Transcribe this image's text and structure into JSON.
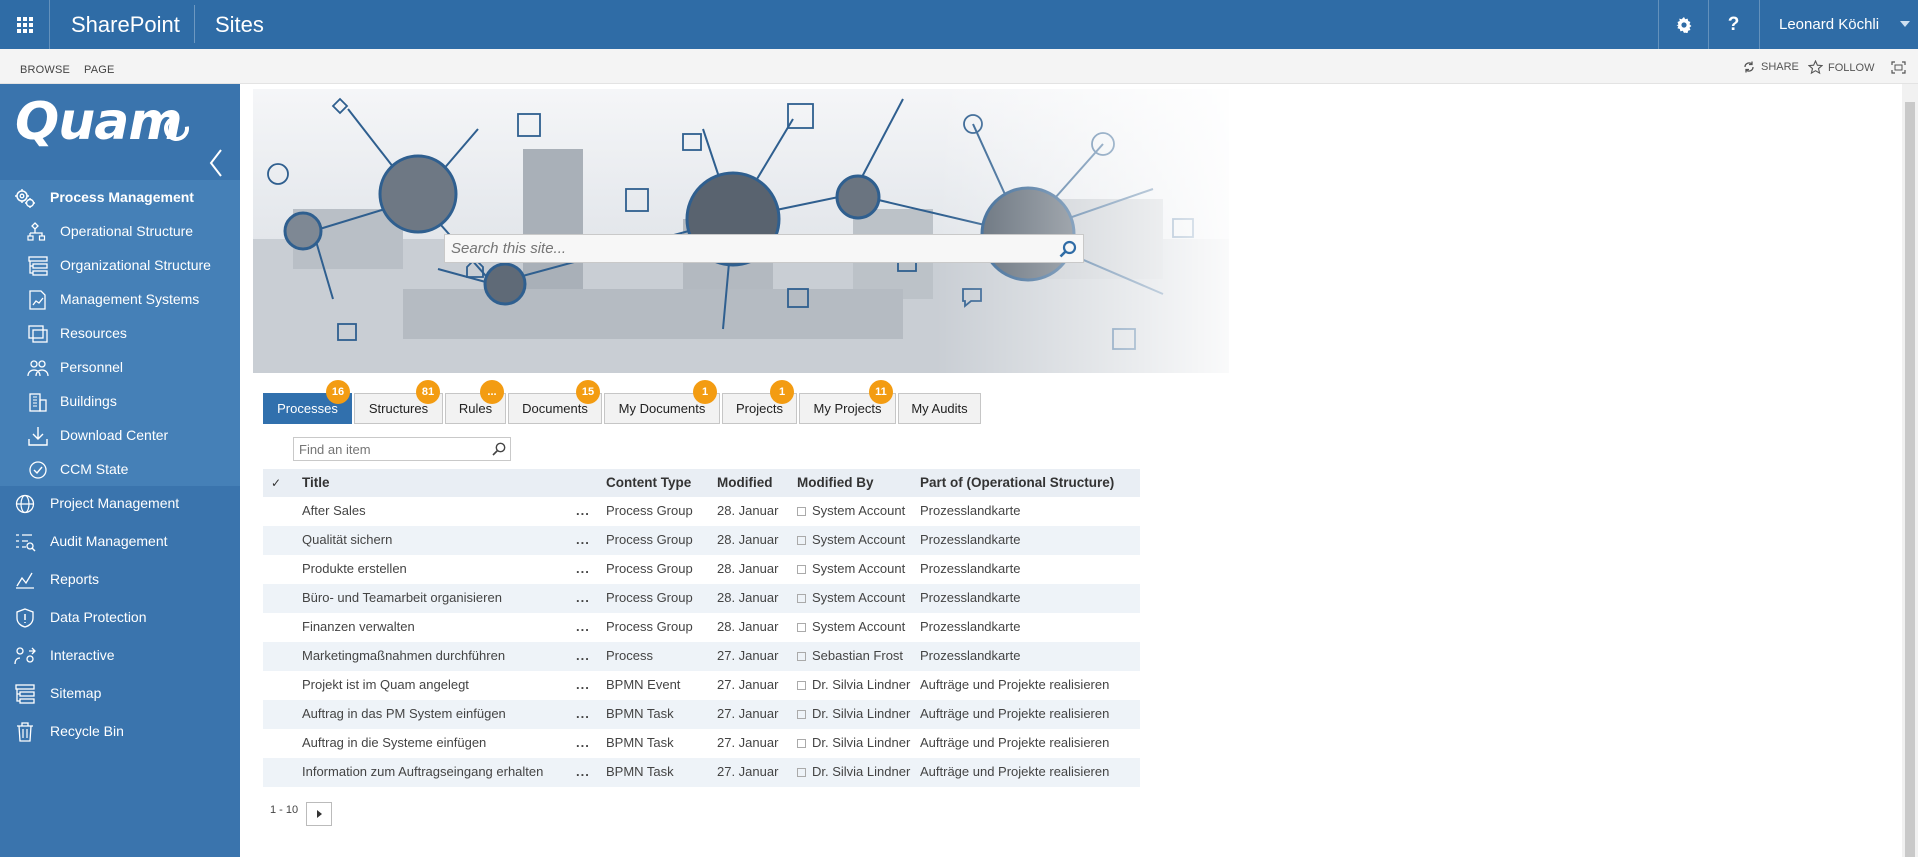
{
  "suitebar": {
    "brand": "SharePoint",
    "section": "Sites",
    "user": "Leonard Köchli",
    "help_label": "?"
  },
  "ribbon": {
    "browse": "BROWSE",
    "page": "PAGE",
    "share": "SHARE",
    "follow": "FOLLOW"
  },
  "logo": {
    "text": "Quam"
  },
  "nav": {
    "items": [
      {
        "label": "Process Management",
        "icon": "gears-icon"
      },
      {
        "label": "Operational Structure",
        "icon": "flowchart-icon"
      },
      {
        "label": "Organizational Structure",
        "icon": "org-chart-icon"
      },
      {
        "label": "Management Systems",
        "icon": "document-chart-icon"
      },
      {
        "label": "Resources",
        "icon": "resources-icon"
      },
      {
        "label": "Personnel",
        "icon": "people-icon"
      },
      {
        "label": "Buildings",
        "icon": "building-icon"
      },
      {
        "label": "Download Center",
        "icon": "download-icon"
      },
      {
        "label": "CCM State",
        "icon": "ccm-icon"
      },
      {
        "label": "Project Management",
        "icon": "globe-icon"
      },
      {
        "label": "Audit Management",
        "icon": "audit-icon"
      },
      {
        "label": "Reports",
        "icon": "chart-icon"
      },
      {
        "label": "Data Protection",
        "icon": "shield-icon"
      },
      {
        "label": "Interactive",
        "icon": "interactive-icon"
      },
      {
        "label": "Sitemap",
        "icon": "sitemap-icon"
      },
      {
        "label": "Recycle Bin",
        "icon": "trash-icon"
      }
    ]
  },
  "search": {
    "placeholder": "Search this site..."
  },
  "tabs": [
    {
      "label": "Processes",
      "badge": "16"
    },
    {
      "label": "Structures",
      "badge": "81"
    },
    {
      "label": "Rules",
      "badge": "..."
    },
    {
      "label": "Documents",
      "badge": "15"
    },
    {
      "label": "My Documents",
      "badge": "1"
    },
    {
      "label": "Projects",
      "badge": "1"
    },
    {
      "label": "My Projects",
      "badge": "11"
    },
    {
      "label": "My Audits",
      "badge": ""
    }
  ],
  "find": {
    "placeholder": "Find an item"
  },
  "table": {
    "headers": {
      "check": "✓",
      "title": "Title",
      "type": "Content Type",
      "modified": "Modified",
      "modified_by": "Modified By",
      "part_of": "Part of (Operational Structure)"
    },
    "rows": [
      {
        "title": "After Sales",
        "dots": "...",
        "type": "Process Group",
        "modified": "28. Januar",
        "modified_by": "System Account",
        "part_of": "Prozesslandkarte"
      },
      {
        "title": "Qualität sichern",
        "dots": "...",
        "type": "Process Group",
        "modified": "28. Januar",
        "modified_by": "System Account",
        "part_of": "Prozesslandkarte"
      },
      {
        "title": "Produkte erstellen",
        "dots": "...",
        "type": "Process Group",
        "modified": "28. Januar",
        "modified_by": "System Account",
        "part_of": "Prozesslandkarte"
      },
      {
        "title": "Büro- und Teamarbeit organisieren",
        "dots": "...",
        "type": "Process Group",
        "modified": "28. Januar",
        "modified_by": "System Account",
        "part_of": "Prozesslandkarte"
      },
      {
        "title": "Finanzen verwalten",
        "dots": "...",
        "type": "Process Group",
        "modified": "28. Januar",
        "modified_by": "System Account",
        "part_of": "Prozesslandkarte"
      },
      {
        "title": "Marketingmaßnahmen durchführen",
        "dots": "...",
        "type": "Process",
        "modified": "27. Januar",
        "modified_by": "Sebastian Frost",
        "part_of": "Prozesslandkarte"
      },
      {
        "title": "Projekt ist im Quam angelegt",
        "dots": "...",
        "type": "BPMN Event",
        "modified": "27. Januar",
        "modified_by": "Dr. Silvia Lindner",
        "part_of": "Aufträge und Projekte realisieren"
      },
      {
        "title": "Auftrag in das PM System einfügen",
        "dots": "...",
        "type": "BPMN Task",
        "modified": "27. Januar",
        "modified_by": "Dr. Silvia Lindner",
        "part_of": "Aufträge und Projekte realisieren"
      },
      {
        "title": "Auftrag in die Systeme einfügen",
        "dots": "...",
        "type": "BPMN Task",
        "modified": "27. Januar",
        "modified_by": "Dr. Silvia Lindner",
        "part_of": "Aufträge und Projekte realisieren"
      },
      {
        "title": "Information zum Auftragseingang erhalten",
        "dots": "...",
        "type": "BPMN Task",
        "modified": "27. Januar",
        "modified_by": "Dr. Silvia Lindner",
        "part_of": "Aufträge und Projekte realisieren"
      }
    ]
  },
  "pager": {
    "range": "1 - 10"
  },
  "colors": {
    "suitebar": "#2f6ca6",
    "nav": "#3a74ad",
    "badge": "#f39c12",
    "active_tab": "#3170ad"
  }
}
